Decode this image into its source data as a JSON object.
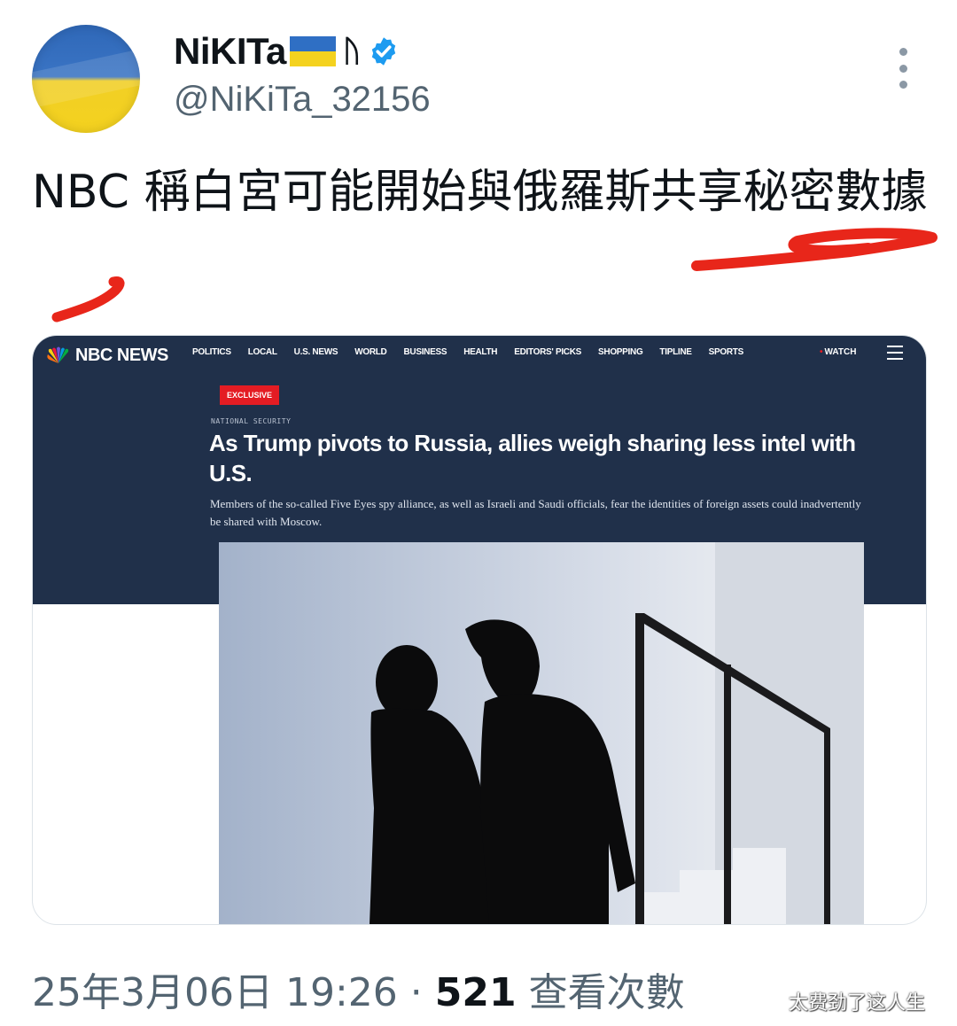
{
  "author": {
    "display_name": "NiKITa",
    "handle": "@NiKiTa_32156",
    "flag_icon": "ukraine-flag-icon",
    "verified_icon": "verified-badge-icon"
  },
  "tweet": {
    "text": "NBC 稱白宮可能開始與俄羅斯共享秘密數據"
  },
  "article": {
    "site_logo": "NBC NEWS",
    "nav_items": [
      "POLITICS",
      "LOCAL",
      "U.S. NEWS",
      "WORLD",
      "BUSINESS",
      "HEALTH",
      "EDITORS' PICKS",
      "SHOPPING",
      "TIPLINE",
      "SPORTS"
    ],
    "watch_label": "WATCH",
    "badge": "EXCLUSIVE",
    "section": "NATIONAL SECURITY",
    "headline": "As Trump pivots to Russia, allies weigh sharing less intel with U.S.",
    "dek": "Members of the so-called Five Eyes spy alliance, as well as Israeli and Saudi officials, fear the identities of foreign assets could inadvertently be shared with Moscow."
  },
  "meta": {
    "timestamp": "25年3月06日 19:26",
    "separator": " · ",
    "views_count": "521",
    "views_label": " 查看次數"
  },
  "watermark": "太费劲了这人生",
  "colors": {
    "nbc_navy": "#20304a",
    "badge_red": "#e41c23",
    "annotation_red": "#e8261a",
    "verified_blue": "#1d9bf0",
    "muted_text": "#536471"
  }
}
